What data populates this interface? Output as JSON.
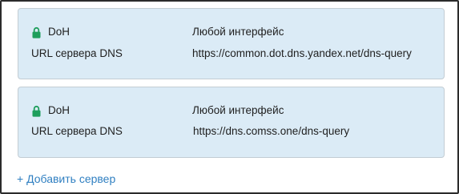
{
  "servers": [
    {
      "protocol": "DoH",
      "interface": "Любой интерфейс",
      "url_label": "URL сервера DNS",
      "url": "https://common.dot.dns.yandex.net/dns-query"
    },
    {
      "protocol": "DoH",
      "interface": "Любой интерфейс",
      "url_label": "URL сервера DNS",
      "url": "https://dns.comss.one/dns-query"
    }
  ],
  "add_server_label": "+ Добавить сервер",
  "icons": {
    "lock": "lock-icon"
  },
  "colors": {
    "card_background": "#dbebf6",
    "lock_green": "#1e9e5c",
    "link_blue": "#2f7fc1"
  }
}
